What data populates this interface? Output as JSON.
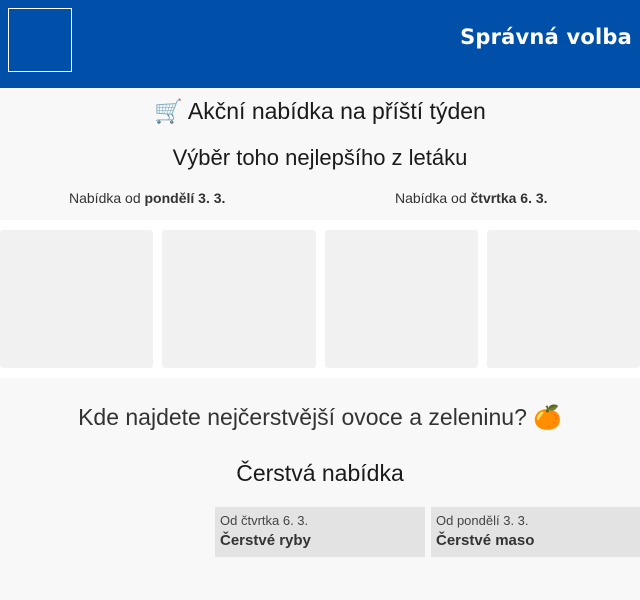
{
  "header": {
    "brand": "Správná volba"
  },
  "offer": {
    "title": "🛒 Akční nabídka na příští týden",
    "subtitle": "Výběr toho nejlepšího z letáku",
    "labels": [
      {
        "prefix": "Nabídka od ",
        "day": "pondělí 3. 3."
      },
      {
        "prefix": "Nabídka od ",
        "day": "čtvrtka 6. 3."
      }
    ]
  },
  "fresh": {
    "question": "Kde najdete nejčerstvější ovoce a zeleninu? 🍊",
    "title": "Čerstvá nabídka",
    "cards": [
      {
        "date": "Od čtvrtka 6. 3.",
        "name": "Čerstvé ryby"
      },
      {
        "date": "Od pondělí 3. 3.",
        "name": "Čerstvé maso"
      }
    ]
  }
}
